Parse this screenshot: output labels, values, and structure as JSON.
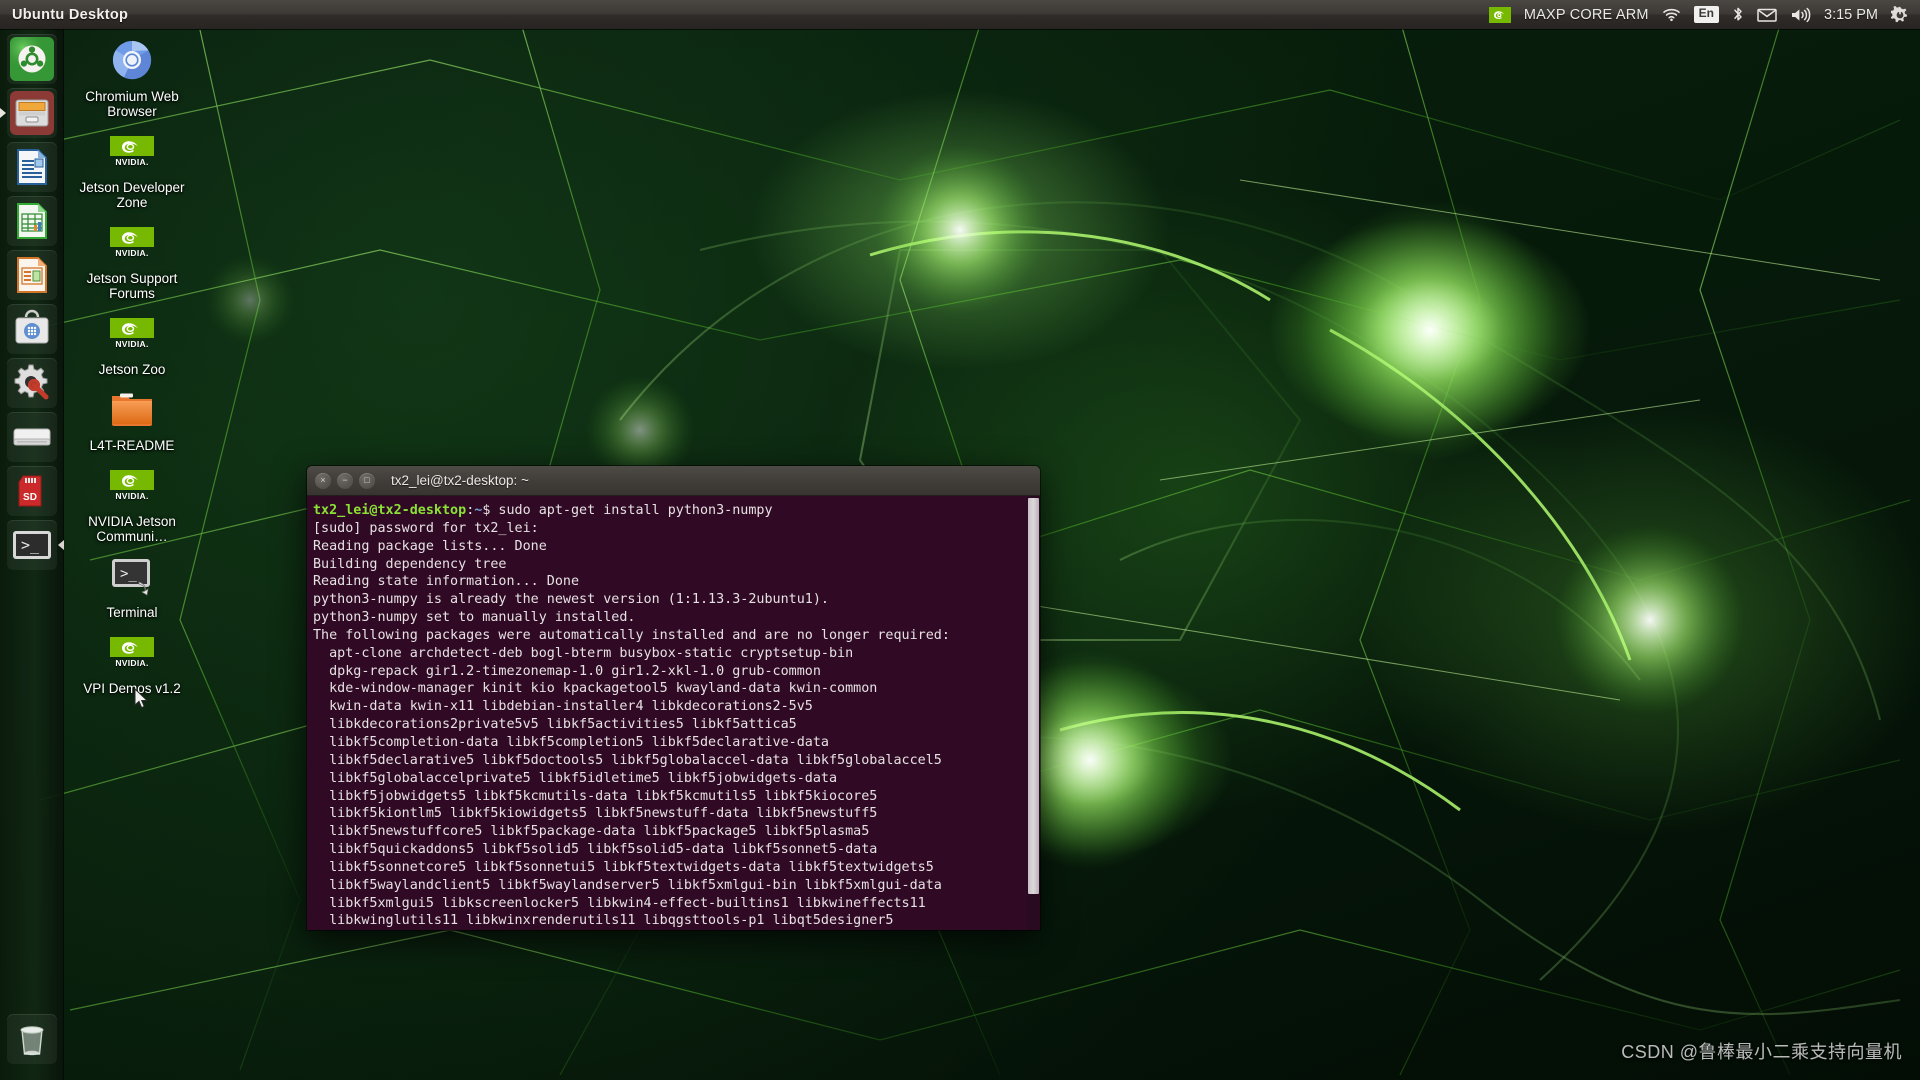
{
  "panel": {
    "title": "Ubuntu Desktop",
    "tray": {
      "nvidia_icon": "nvidia-logo-icon",
      "label": "MAXP CORE ARM",
      "wifi_icon": "wifi-icon",
      "keyboard_indicator": "En",
      "bluetooth_icon": "bluetooth-icon",
      "mail_icon": "mail-icon",
      "volume_icon": "volume-icon",
      "clock": "3:15 PM",
      "session_icon": "power-gear-icon"
    }
  },
  "launcher": {
    "items": [
      {
        "name": "ubuntu-dash",
        "label": "Dash home",
        "icon": "ubuntu-logo-icon"
      },
      {
        "name": "files",
        "label": "Files",
        "icon": "file-manager-icon"
      },
      {
        "name": "libreoffice-writer",
        "label": "LibreOffice Writer",
        "icon": "writer-icon"
      },
      {
        "name": "libreoffice-calc",
        "label": "LibreOffice Calc",
        "icon": "calc-icon"
      },
      {
        "name": "libreoffice-impress",
        "label": "LibreOffice Impress",
        "icon": "impress-icon"
      },
      {
        "name": "software-center",
        "label": "Ubuntu Software",
        "icon": "software-bag-icon"
      },
      {
        "name": "system-settings",
        "label": "System Settings",
        "icon": "gear-wrench-icon"
      },
      {
        "name": "disk-drive",
        "label": "Drive",
        "icon": "hard-drive-icon"
      },
      {
        "name": "sd-card",
        "label": "SD Card",
        "icon": "sd-card-icon"
      },
      {
        "name": "terminal",
        "label": "Terminal",
        "icon": "terminal-icon"
      }
    ],
    "trash": {
      "name": "trash",
      "label": "Trash",
      "icon": "trash-icon"
    }
  },
  "desktop_icons": [
    {
      "label": "Chromium Web Browser",
      "icon": "chromium-icon"
    },
    {
      "label": "NVIDIA Jetson Developer Zone",
      "icon": "nvidia-icon",
      "brand": "NVIDIA.",
      "text": "Jetson Developer Zone"
    },
    {
      "label": "NVIDIA Jetson Support Forums",
      "icon": "nvidia-icon",
      "brand": "NVIDIA.",
      "text": "Jetson Support Forums"
    },
    {
      "label": "NVIDIA Jetson Zoo",
      "icon": "nvidia-icon",
      "brand": "NVIDIA.",
      "text": "Jetson Zoo"
    },
    {
      "label": "L4T-README",
      "icon": "folder-icon",
      "text": "L4T-README"
    },
    {
      "label": "NVIDIA Jetson Communi...",
      "icon": "nvidia-icon",
      "brand": "NVIDIA.",
      "text": "NVIDIA Jetson Communi…"
    },
    {
      "label": "Terminal",
      "icon": "terminal-icon",
      "text": "Terminal"
    },
    {
      "label": "NVIDIA VPI Demos v1.2",
      "icon": "nvidia-icon",
      "brand": "NVIDIA.",
      "text": "VPI Demos v1.2"
    }
  ],
  "terminal": {
    "title": "tx2_lei@tx2-desktop: ~",
    "buttons": {
      "close": "×",
      "minimize": "−",
      "maximize": "□"
    },
    "prompt": {
      "user_host": "tx2_lei@tx2-desktop",
      "colon": ":",
      "path": "~",
      "sigil": "$",
      "command": " sudo apt-get install python3-numpy"
    },
    "output": [
      "[sudo] password for tx2_lei:",
      "Reading package lists... Done",
      "Building dependency tree",
      "Reading state information... Done",
      "python3-numpy is already the newest version (1:1.13.3-2ubuntu1).",
      "python3-numpy set to manually installed.",
      "The following packages were automatically installed and are no longer required:",
      "  apt-clone archdetect-deb bogl-bterm busybox-static cryptsetup-bin",
      "  dpkg-repack gir1.2-timezonemap-1.0 gir1.2-xkl-1.0 grub-common",
      "  kde-window-manager kinit kio kpackagetool5 kwayland-data kwin-common",
      "  kwin-data kwin-x11 libdebian-installer4 libkdecorations2-5v5",
      "  libkdecorations2private5v5 libkf5activities5 libkf5attica5",
      "  libkf5completion-data libkf5completion5 libkf5declarative-data",
      "  libkf5declarative5 libkf5doctools5 libkf5globalaccel-data libkf5globalaccel5",
      "  libkf5globalaccelprivate5 libkf5idletime5 libkf5jobwidgets-data",
      "  libkf5jobwidgets5 libkf5kcmutils-data libkf5kcmutils5 libkf5kiocore5",
      "  libkf5kiontlm5 libkf5kiowidgets5 libkf5newstuff-data libkf5newstuff5",
      "  libkf5newstuffcore5 libkf5package-data libkf5package5 libkf5plasma5",
      "  libkf5quickaddons5 libkf5solid5 libkf5solid5-data libkf5sonnet5-data",
      "  libkf5sonnetcore5 libkf5sonnetui5 libkf5textwidgets-data libkf5textwidgets5",
      "  libkf5waylandclient5 libkf5waylandserver5 libkf5xmlgui-bin libkf5xmlgui-data",
      "  libkf5xmlgui5 libkscreenlocker5 libkwin4-effect-builtins1 libkwineffects11",
      "  libkwinglutils11 libkwinxrenderutils11 libqgsttools-p1 libqt5designer5"
    ]
  },
  "watermark": "CSDN @鲁棒最小二乘支持向量机",
  "colors": {
    "panel_bg": "#3d3a36",
    "terminal_bg": "#300a24",
    "prompt_green": "#8ae234",
    "prompt_blue": "#729fcf",
    "nvidia_green": "#76b900",
    "text": "#e6e1e3"
  }
}
